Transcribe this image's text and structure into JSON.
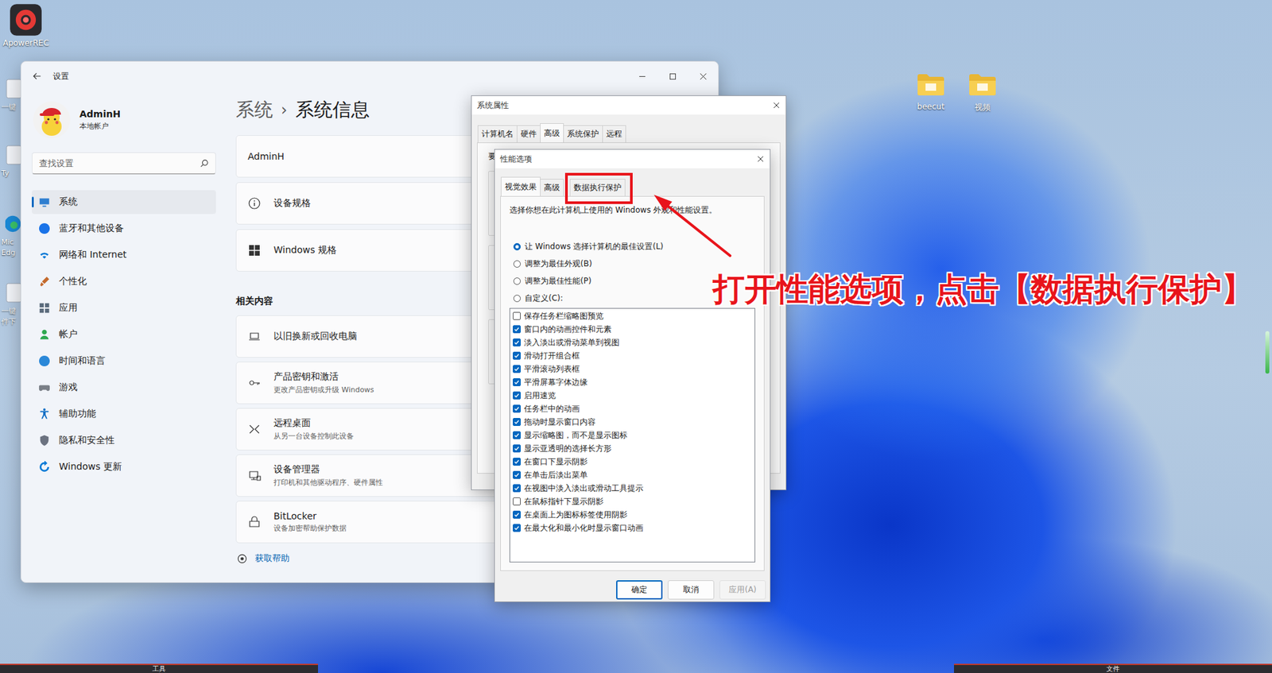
{
  "desktop": {
    "icons": [
      {
        "label": "ApowerREC",
        "kind": "app"
      },
      {
        "label": "beecut",
        "kind": "folder"
      },
      {
        "label": "视频",
        "kind": "folder"
      }
    ],
    "edge_icons": [
      {
        "lines": [
          "一键"
        ]
      },
      {
        "lines": [
          "Ty"
        ]
      },
      {
        "lines": [
          "Mic",
          "Edg"
        ]
      },
      {
        "lines": [
          "一键",
          "件下"
        ]
      }
    ]
  },
  "settings": {
    "title": "设置",
    "user": {
      "name": "AdminH",
      "account": "本地帐户"
    },
    "search": {
      "placeholder": "查找设置"
    },
    "nav": [
      {
        "label": "系统",
        "selected": true
      },
      {
        "label": "蓝牙和其他设备",
        "selected": false
      },
      {
        "label": "网络和 Internet",
        "selected": false
      },
      {
        "label": "个性化",
        "selected": false
      },
      {
        "label": "应用",
        "selected": false
      },
      {
        "label": "帐户",
        "selected": false
      },
      {
        "label": "时间和语言",
        "selected": false
      },
      {
        "label": "游戏",
        "selected": false
      },
      {
        "label": "辅助功能",
        "selected": false
      },
      {
        "label": "隐私和安全性",
        "selected": false
      },
      {
        "label": "Windows 更新",
        "selected": false
      }
    ],
    "breadcrumb": [
      {
        "label": "系统",
        "current": false
      },
      {
        "label": "系统信息",
        "current": true
      }
    ],
    "separator": "›",
    "top_cards": [
      {
        "title": "AdminH"
      },
      {
        "title": "设备规格"
      },
      {
        "title": "Windows 规格"
      }
    ],
    "related_heading": "相关内容",
    "related": [
      {
        "title": "以旧换新或回收电脑"
      },
      {
        "title": "产品密钥和激活",
        "subtitle": "更改产品密钥或升级 Windows"
      },
      {
        "title": "远程桌面",
        "subtitle": "从另一台设备控制此设备"
      },
      {
        "title": "设备管理器",
        "subtitle": "打印机和其他驱动程序、硬件属性"
      },
      {
        "title": "BitLocker",
        "subtitle": "设备加密帮助保护数据"
      }
    ],
    "help": "获取帮助"
  },
  "system_properties": {
    "title": "系统属性",
    "tabs": [
      {
        "label": "计算机名",
        "selected": false
      },
      {
        "label": "硬件",
        "selected": false
      },
      {
        "label": "高级",
        "selected": true
      },
      {
        "label": "系统保护",
        "selected": false
      },
      {
        "label": "远程",
        "selected": false
      }
    ],
    "fragment": "要"
  },
  "performance_options": {
    "title": "性能选项",
    "tabs": [
      {
        "label": "视觉效果",
        "selected": true,
        "highlighted": false
      },
      {
        "label": "高级",
        "selected": false,
        "highlighted": false
      },
      {
        "label": "数据执行保护",
        "selected": false,
        "highlighted": true
      }
    ],
    "description": "选择你想在此计算机上使用的 Windows 外观和性能设置。",
    "radios": [
      {
        "label": "让 Windows 选择计算机的最佳设置(L)",
        "selected": true
      },
      {
        "label": "调整为最佳外观(B)",
        "selected": false
      },
      {
        "label": "调整为最佳性能(P)",
        "selected": false
      },
      {
        "label": "自定义(C):",
        "selected": false
      }
    ],
    "options": [
      {
        "label": "保存任务栏缩略图预览",
        "checked": false
      },
      {
        "label": "窗口内的动画控件和元素",
        "checked": true
      },
      {
        "label": "淡入淡出或滑动菜单到视图",
        "checked": true
      },
      {
        "label": "滑动打开组合框",
        "checked": true
      },
      {
        "label": "平滑滚动列表框",
        "checked": true
      },
      {
        "label": "平滑屏幕字体边缘",
        "checked": true
      },
      {
        "label": "启用速览",
        "checked": true
      },
      {
        "label": "任务栏中的动画",
        "checked": true
      },
      {
        "label": "拖动时显示窗口内容",
        "checked": true
      },
      {
        "label": "显示缩略图，而不是显示图标",
        "checked": true
      },
      {
        "label": "显示亚透明的选择长方形",
        "checked": true
      },
      {
        "label": "在窗口下显示阴影",
        "checked": true
      },
      {
        "label": "在单击后淡出菜单",
        "checked": true
      },
      {
        "label": "在视图中淡入淡出或滑动工具提示",
        "checked": true
      },
      {
        "label": "在鼠标指针下显示阴影",
        "checked": false
      },
      {
        "label": "在桌面上为图标标签使用阴影",
        "checked": true
      },
      {
        "label": "在最大化和最小化时显示窗口动画",
        "checked": true
      }
    ],
    "buttons": [
      {
        "label": "确定",
        "primary": true,
        "disabled": false
      },
      {
        "label": "取消",
        "primary": false,
        "disabled": false
      },
      {
        "label": "应用(A)",
        "primary": false,
        "disabled": true
      }
    ]
  },
  "annotation": {
    "text": "打开性能选项，点击【数据执行保护】"
  },
  "taskbar": {
    "labels": [
      "工具",
      "文件"
    ]
  }
}
